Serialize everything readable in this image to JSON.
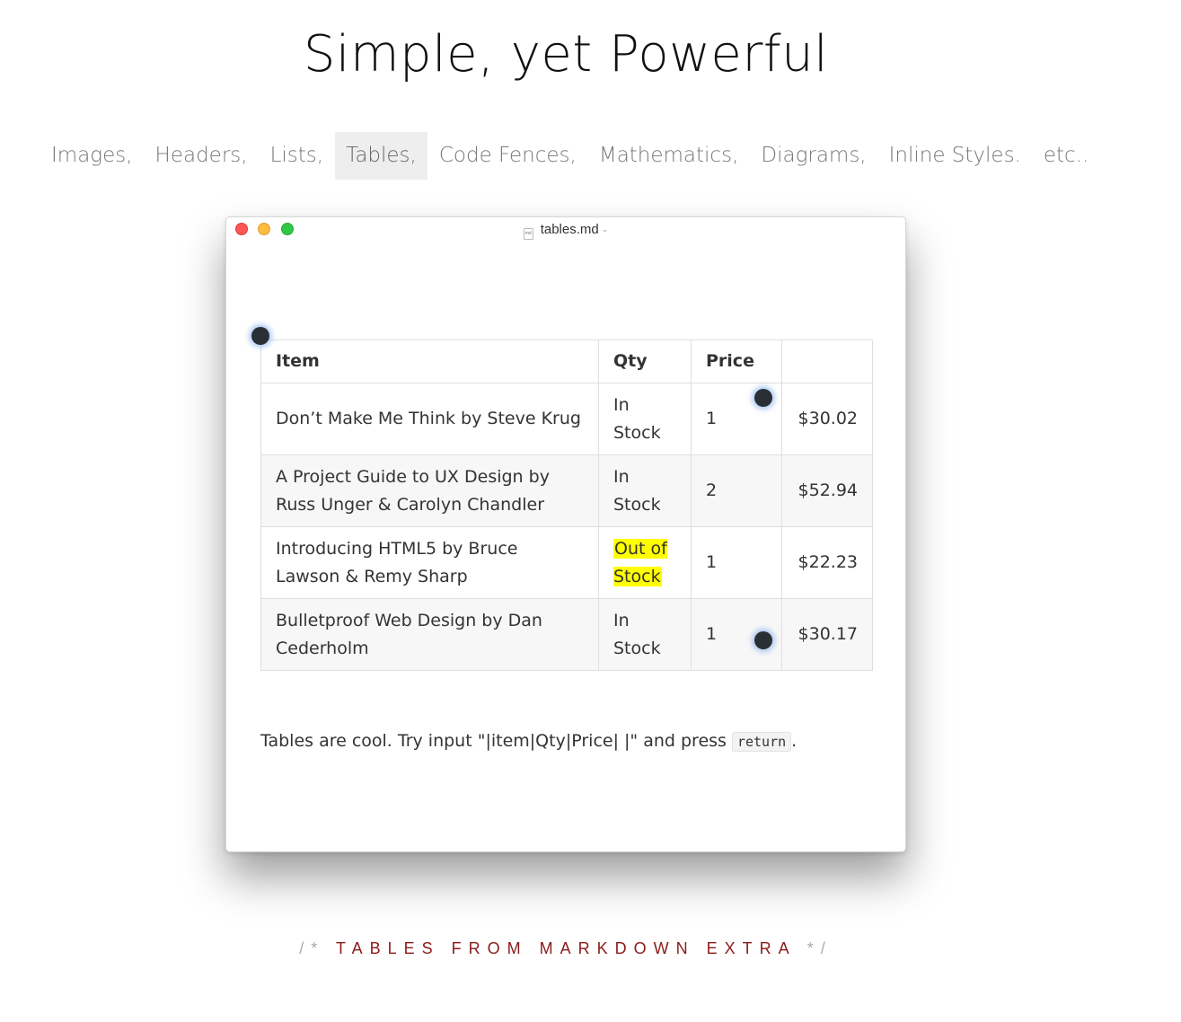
{
  "headline": "Simple, yet Powerful",
  "nav": {
    "items": [
      {
        "label": "Images,",
        "active": false
      },
      {
        "label": "Headers,",
        "active": false
      },
      {
        "label": "Lists,",
        "active": false
      },
      {
        "label": "Tables,",
        "active": true
      },
      {
        "label": "Code Fences,",
        "active": false
      },
      {
        "label": "Mathematics,",
        "active": false
      },
      {
        "label": "Diagrams,",
        "active": false
      },
      {
        "label": "Inline Styles.",
        "active": false
      },
      {
        "label": "etc..",
        "active": false
      }
    ]
  },
  "window": {
    "title": "tables.md",
    "file_icon": "md",
    "colors": {
      "close": "#fc5753",
      "minimize": "#fdbc40",
      "zoom": "#33c748"
    }
  },
  "table": {
    "headers": [
      "Item",
      "Qty",
      "Price",
      ""
    ],
    "rows": [
      {
        "item": "Don’t Make Me Think by Steve Krug",
        "qty": "In Stock",
        "price": "1",
        "total": "$30.02"
      },
      {
        "item": "A Project Guide to UX Design by Russ Unger & Carolyn Chandler",
        "qty": "In Stock",
        "price": "2",
        "total": "$52.94"
      },
      {
        "item": "Introducing HTML5 by Bruce Lawson & Remy Sharp",
        "qty": "Out of Stock",
        "price": "1",
        "total": "$22.23"
      },
      {
        "item": "Bulletproof Web Design by Dan Cederholm",
        "qty": "In Stock",
        "price": "1",
        "total": "$30.17"
      }
    ],
    "highlight_color": "#ffff00"
  },
  "note": {
    "text": "Tables are cool. Try input \"|item|Qty|Price| |\" and press ",
    "code": "return",
    "after": "."
  },
  "caption": {
    "open": "/* ",
    "words": "TABLES FROM MARKDOWN EXTRA",
    "close": " */",
    "color": "#8b1a1a"
  }
}
